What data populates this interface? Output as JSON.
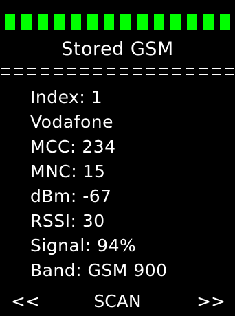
{
  "screen": {
    "title": "Stored GSM",
    "signal_bar": {
      "segments_total": 14,
      "segments_on": 14,
      "color_on": "#00ff00"
    },
    "divider_dash_count": 18
  },
  "info": {
    "index_line": "Index: 1",
    "operator_line": "Vodafone",
    "mcc_line": "MCC: 234",
    "mnc_line": "MNC: 15",
    "dbm_line": "dBm: -67",
    "rssi_line": "RSSI: 30",
    "signal_line": "Signal: 94%",
    "band_line": "Band: GSM 900"
  },
  "footer": {
    "prev_label": "<<",
    "scan_label": "SCAN",
    "next_label": ">>"
  },
  "colors": {
    "background": "#000000",
    "text": "#ffffff",
    "accent": "#00ff00"
  }
}
